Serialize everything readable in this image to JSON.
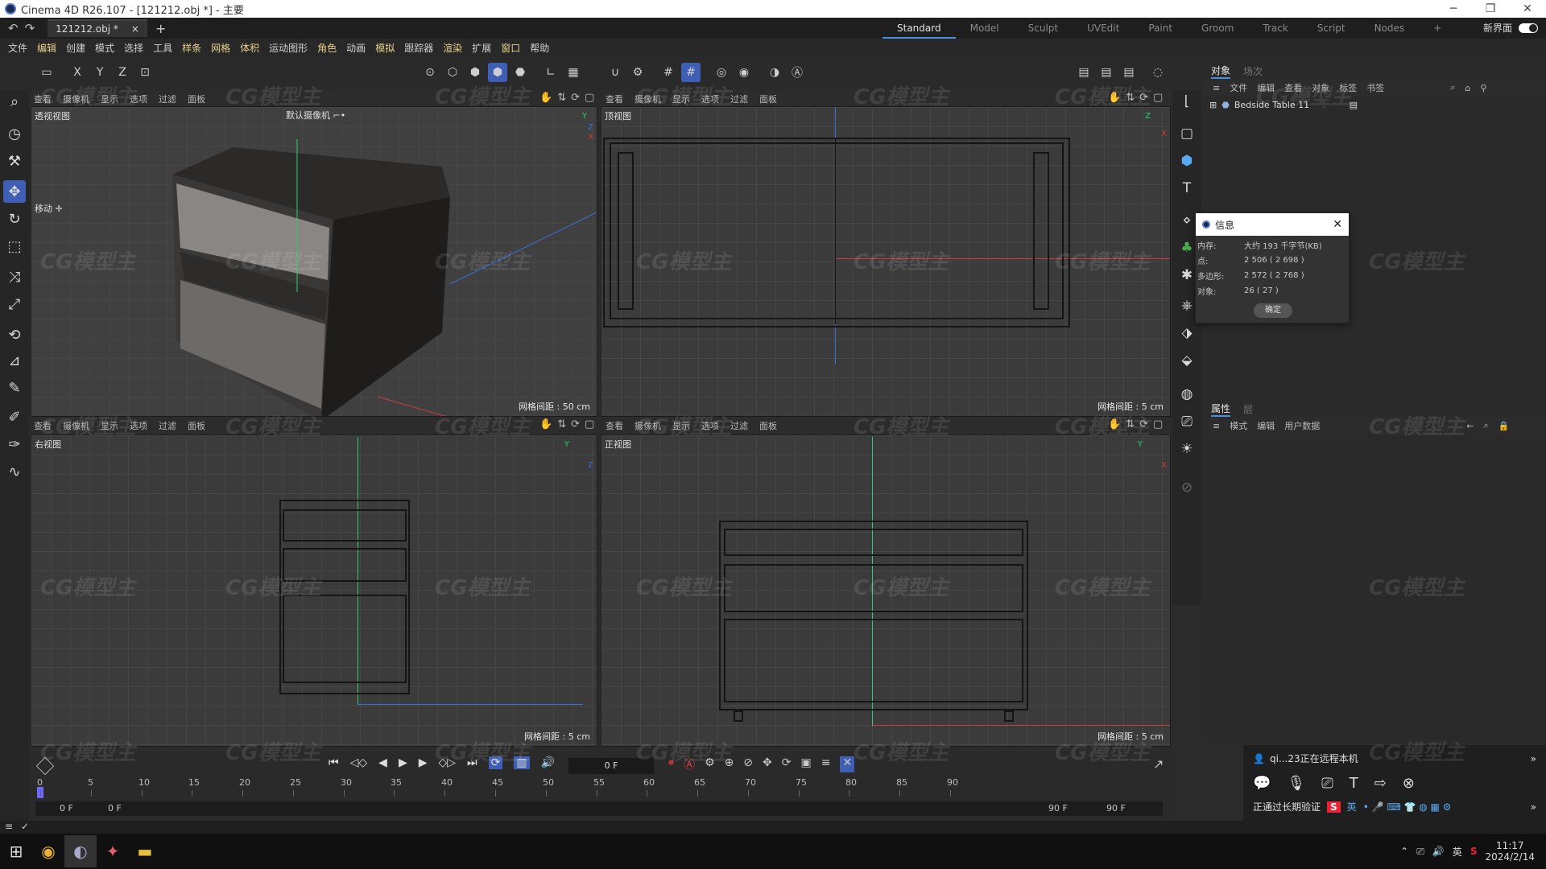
{
  "titlebar": {
    "title": "Cinema 4D R26.107 - [121212.obj *] - 主要",
    "minimize": "─",
    "restore": "❐",
    "close": "✕"
  },
  "tabs": {
    "undo": "↶",
    "redo": "↷",
    "doc_tab": "121212.obj *",
    "close_tab": "×",
    "add_tab": "+",
    "layouts": [
      "Standard",
      "Model",
      "Sculpt",
      "UVEdit",
      "Paint",
      "Groom",
      "Track",
      "Script",
      "Nodes"
    ],
    "layouts_add": "+",
    "new_layout": "新界面"
  },
  "menubar": [
    "文件",
    "编辑",
    "创建",
    "模式",
    "选择",
    "工具",
    "样条",
    "网格",
    "体积",
    "运动图形",
    "角色",
    "动画",
    "模拟",
    "跟踪器",
    "渲染",
    "扩展",
    "窗口",
    "帮助"
  ],
  "toolbar": {
    "axes": [
      "X",
      "Y",
      "Z"
    ]
  },
  "viewports": {
    "menu": [
      "查看",
      "摄像机",
      "显示",
      "选项",
      "过滤",
      "面板"
    ],
    "perspective": {
      "title": "透视视图",
      "camera": "默认摄像机 ⌐•",
      "grid": "网格间距 : 50 cm",
      "move_label": "移动 ✛"
    },
    "top": {
      "title": "顶视图",
      "grid": "网格间距 : 5 cm"
    },
    "right": {
      "title": "右视图",
      "grid": "网格间距 : 5 cm"
    },
    "front": {
      "title": "正视图",
      "grid": "网格间距 : 5 cm"
    },
    "axis_labels": {
      "x": "X",
      "y": "Y",
      "z": "Z"
    }
  },
  "object_manager": {
    "tabs": [
      "对象",
      "场次"
    ],
    "menu": [
      "文件",
      "编辑",
      "查看",
      "对象",
      "标签",
      "书签"
    ],
    "item": "Bedside Table 11"
  },
  "attribute_manager": {
    "tabs": [
      "属性",
      "层"
    ],
    "menu": [
      "模式",
      "编辑",
      "用户数据"
    ]
  },
  "info_dialog": {
    "title": "信息",
    "rows": [
      {
        "k": "内存:",
        "v": "大约 193 千字节(KB)"
      },
      {
        "k": "点:",
        "v": "2 506 ( 2 698 )"
      },
      {
        "k": "多边形:",
        "v": "2 572 ( 2 768 )"
      },
      {
        "k": "对象:",
        "v": "26 ( 27 )"
      }
    ],
    "ok": "确定"
  },
  "timeline": {
    "current_frame": "0 F",
    "start_frame": "0 F",
    "start_frame2": "0 F",
    "end_frame": "90 F",
    "end_frame2": "90 F",
    "ticks": [
      "0",
      "5",
      "10",
      "15",
      "20",
      "25",
      "30",
      "35",
      "40",
      "45",
      "50",
      "55",
      "60",
      "65",
      "70",
      "75",
      "80",
      "85",
      "90"
    ]
  },
  "remote": {
    "status": "qi...23正在远程本机",
    "verify": "正通过长期验证",
    "ime": "英"
  },
  "taskbar": {
    "time": "11:17",
    "date": "2024/2/14",
    "lang": "英"
  },
  "watermark": "CG模型主"
}
